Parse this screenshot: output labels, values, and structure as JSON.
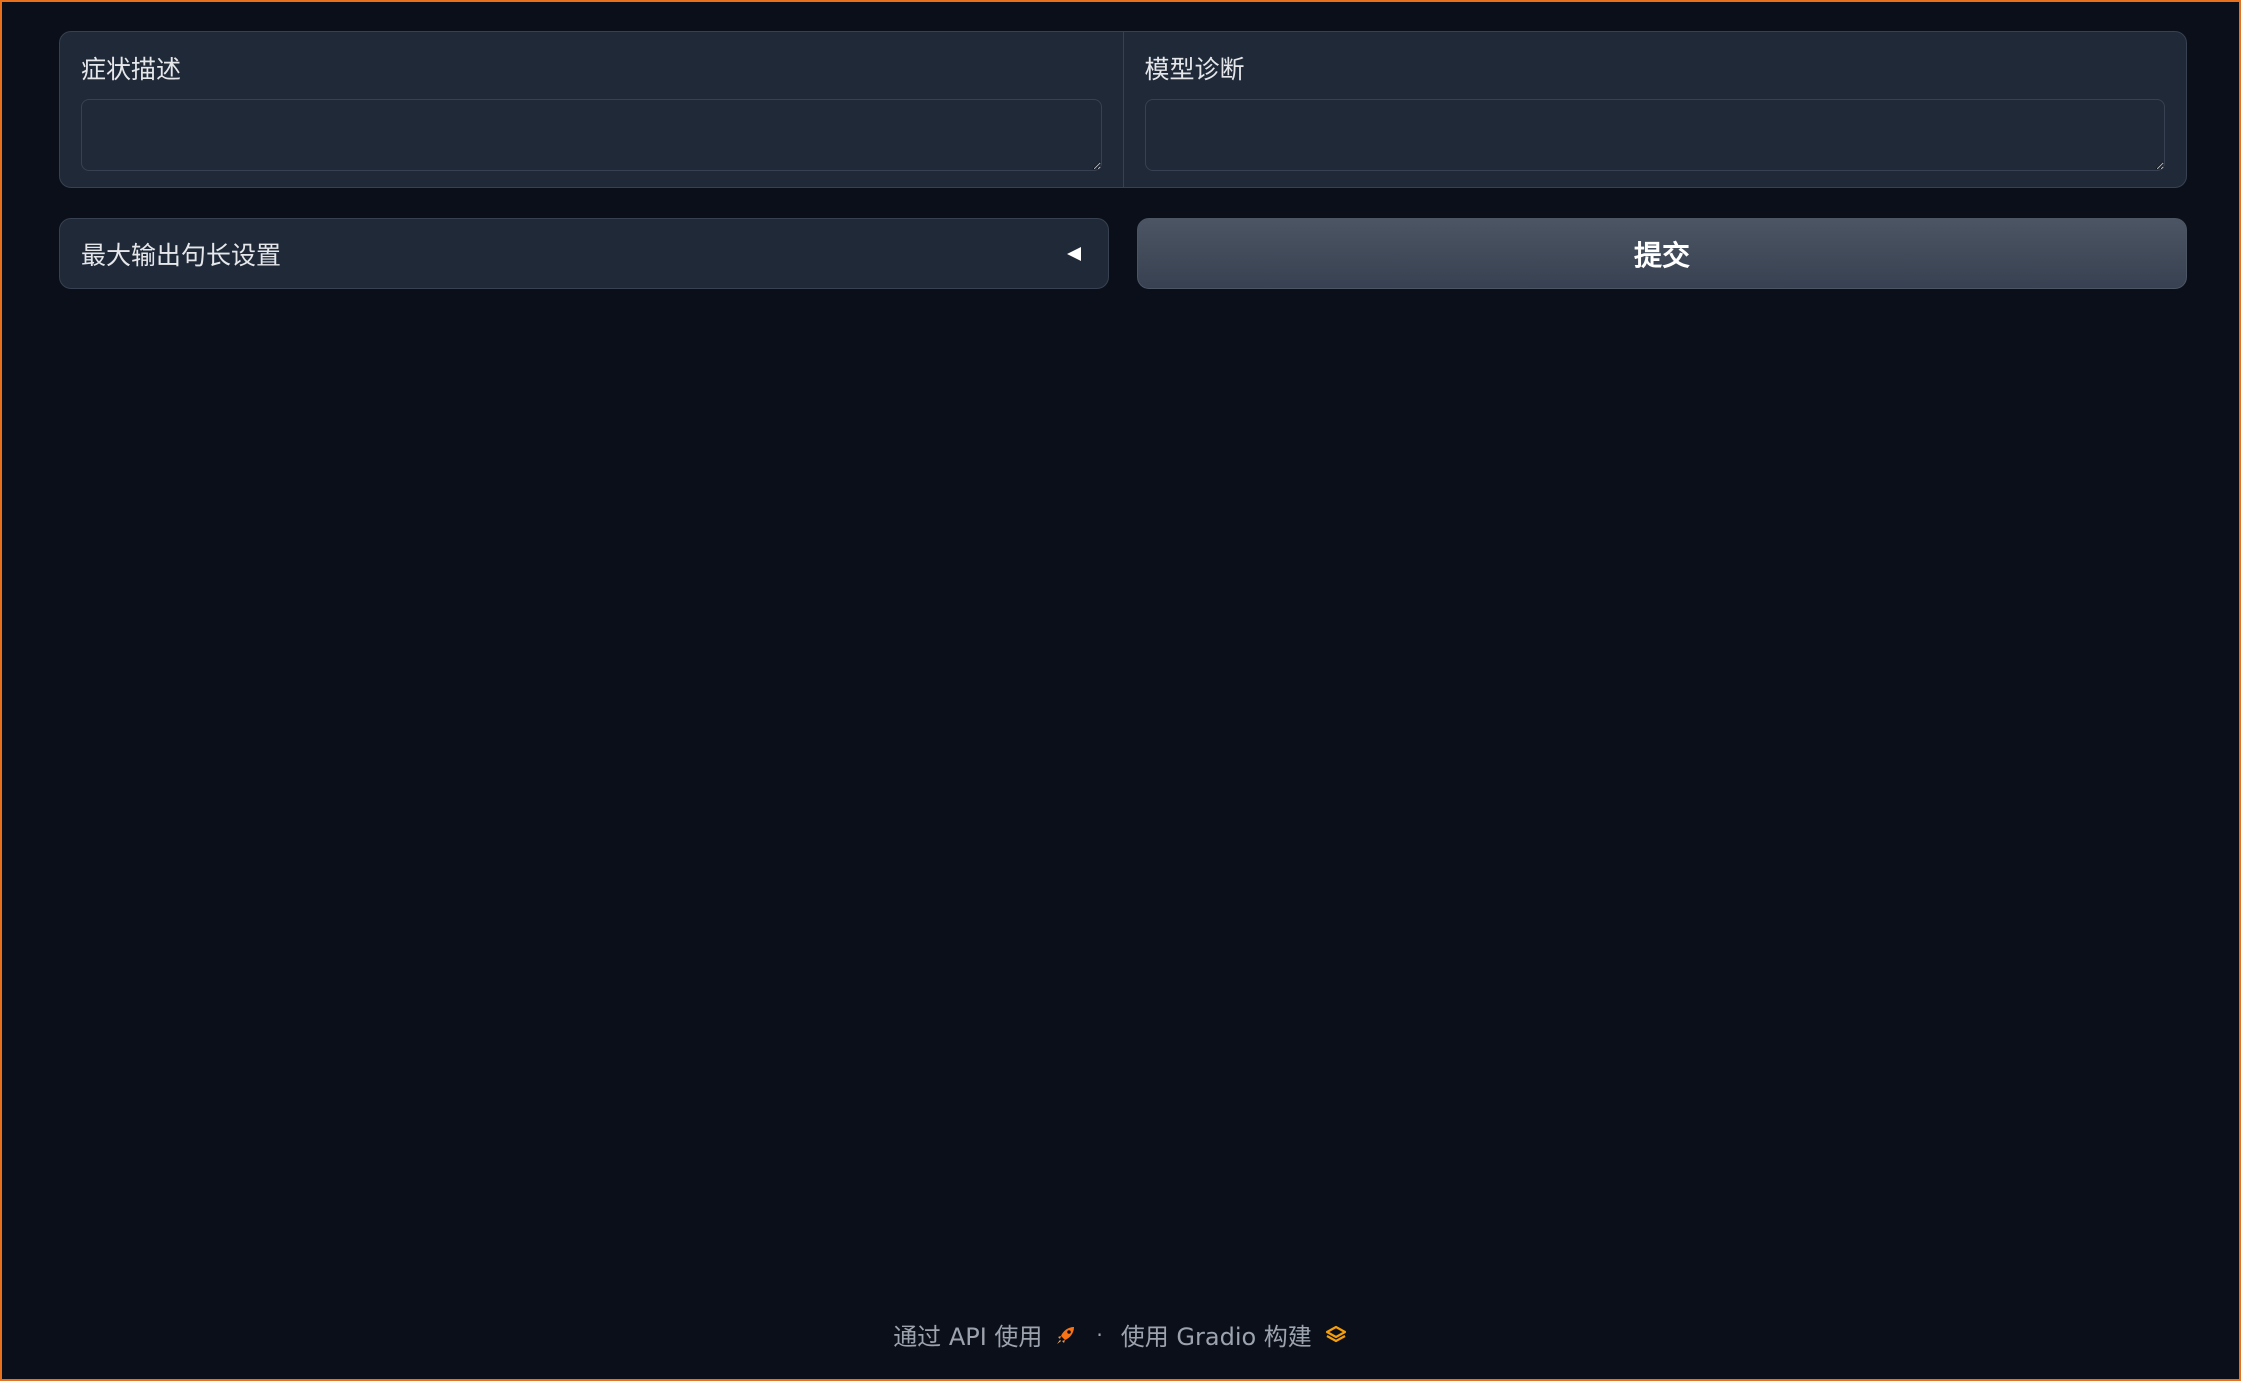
{
  "inputs": {
    "symptom": {
      "label": "症状描述",
      "value": "",
      "placeholder": ""
    },
    "diagnosis": {
      "label": "模型诊断",
      "value": "",
      "placeholder": ""
    }
  },
  "accordion": {
    "label": "最大输出句长设置",
    "collapsed": true,
    "arrow_icon": "triangle-left-icon"
  },
  "submit": {
    "label": "提交"
  },
  "footer": {
    "api_link": "通过 API 使用",
    "api_icon": "rocket-icon",
    "separator": "·",
    "built_with": "使用 Gradio 构建",
    "gradio_icon": "gradio-logo-icon"
  },
  "colors": {
    "background": "#0b0f19",
    "panel": "#1f2937",
    "border": "#374151",
    "frame_border": "#e8711d",
    "button": "#4b5563",
    "gradio_orange": "#f59e0b",
    "rocket_orange": "#f97316"
  }
}
